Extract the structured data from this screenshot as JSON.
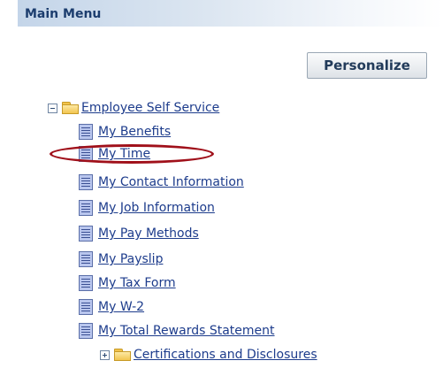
{
  "header": {
    "title": "Main Menu"
  },
  "toolbar": {
    "personalize_label": "Personalize"
  },
  "tree": {
    "root": {
      "label": "Employee Self Service"
    },
    "items": [
      {
        "label": "My Benefits"
      },
      {
        "label": "My Time"
      },
      {
        "label": "My Contact Information"
      },
      {
        "label": "My Job Information"
      },
      {
        "label": "My Pay Methods"
      },
      {
        "label": "My Payslip"
      },
      {
        "label": "My Tax Form"
      },
      {
        "label": "My W-2"
      },
      {
        "label": "My Total Rewards Statement"
      }
    ],
    "collapsed_folder": {
      "label": "Certifications and Disclosures"
    }
  },
  "annotation": {
    "highlighted_item": "My Time",
    "color": "#a0101a"
  }
}
